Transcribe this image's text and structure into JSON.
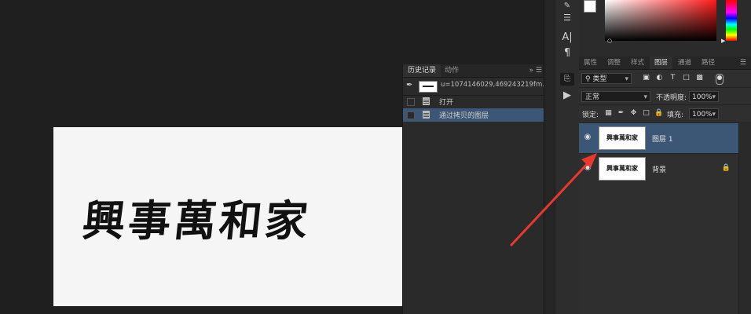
{
  "canvas": {
    "artwork_text": "興事萬和家"
  },
  "history_panel": {
    "tabs": [
      {
        "label": "历史记录",
        "active": true
      },
      {
        "label": "动作",
        "active": false
      }
    ],
    "collapse_icon": "double-chevron-right-icon",
    "menu_icon": "menu-icon",
    "snapshot_label": "u=1074146029,469243219fm...",
    "items": [
      {
        "label": "打开",
        "selected": false
      },
      {
        "label": "通过拷贝的图层",
        "selected": true
      }
    ]
  },
  "tools": {
    "items": [
      "character-panel-icon",
      "paragraph-icon",
      "brush-settings-icon",
      "play-icon"
    ]
  },
  "color": {
    "foreground": "#ffffff",
    "background": "#ffee00"
  },
  "layers_panel": {
    "tabs": [
      {
        "label": "属性",
        "active": false
      },
      {
        "label": "调整",
        "active": false
      },
      {
        "label": "样式",
        "active": false
      },
      {
        "label": "图层",
        "active": true
      },
      {
        "label": "通道",
        "active": false
      },
      {
        "label": "路径",
        "active": false
      }
    ],
    "filter_label": "类型",
    "blend_mode": "正常",
    "opacity_label": "不透明度:",
    "opacity_value": "100%",
    "lock_label": "锁定:",
    "fill_label": "填充:",
    "fill_value": "100%",
    "layers": [
      {
        "name": "图层 1",
        "selected": true,
        "thumb_text": "興事萬和家"
      },
      {
        "name": "背景",
        "selected": false,
        "locked": true,
        "thumb_text": "興事萬和家"
      }
    ]
  },
  "annotation": {
    "arrow_color": "#e8392f"
  }
}
